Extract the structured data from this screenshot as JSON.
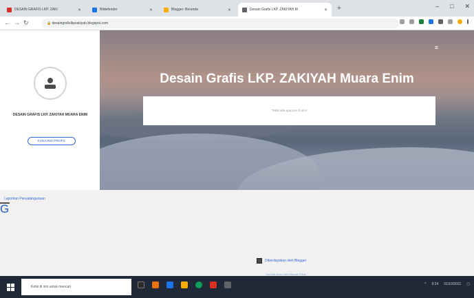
{
  "browser": {
    "tabs": [
      {
        "label": "DESAIN GRAFIS LKP. ZAKI",
        "favicon_color": "#d93025",
        "active": false
      },
      {
        "label": "Bitdefender",
        "favicon_color": "#1a73e8",
        "active": false
      },
      {
        "label": "Blogger: Beranda",
        "favicon_color": "#f9ab00",
        "active": false
      },
      {
        "label": "Desain Grafis LKP. ZAKIYAH M",
        "favicon_color": "#5f6368",
        "active": true
      }
    ],
    "new_tab": "+",
    "window_buttons": {
      "minimize": "–",
      "maximize": "□",
      "close": "✕"
    },
    "url": "desaingrafislkpzakiyah.blogspot.com",
    "nav": {
      "back": "←",
      "forward": "→",
      "reload": "↻"
    }
  },
  "sidebar": {
    "site_name": "DESAIN GRAFIS LKP. ZAKIYAH MUARA ENIM",
    "visit_button": "KUNJUNGI PROFIL",
    "link": "Laporkan Penyalahgunaan"
  },
  "hero": {
    "title": "Desain Grafis LKP. ZAKIYAH Muara Enim",
    "search_placeholder": "Tidak ada apa pun di sini!",
    "menu_icon": "≡"
  },
  "footer": {
    "powered_by": "Diberdayakan oleh Blogger",
    "note": "Gambar tema oleh Michael Elkan"
  },
  "partial_fragment": "G",
  "taskbar": {
    "search_placeholder": "Ketik di sini untuk mencari",
    "time": "9:24",
    "date": "01/10/2021"
  },
  "colors": {
    "accent": "#3367d6",
    "taskbar": "#1f2937"
  }
}
